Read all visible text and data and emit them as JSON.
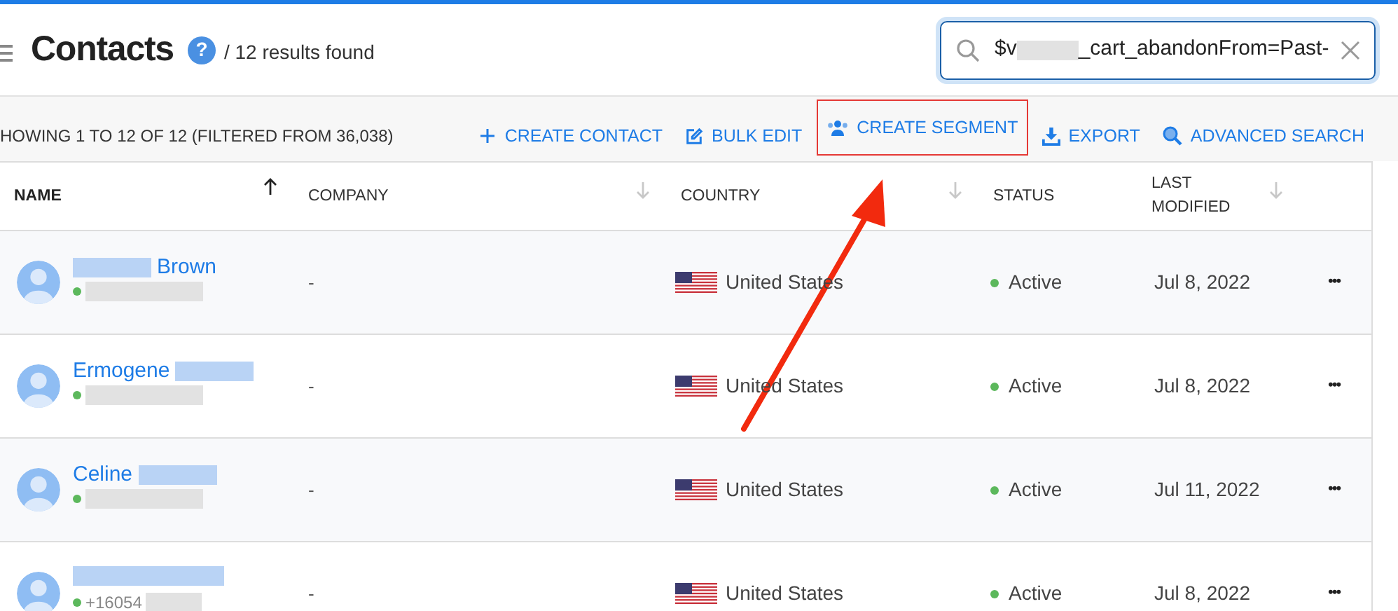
{
  "header": {
    "title": "Contacts",
    "help": "?",
    "results": "/ 12 results found"
  },
  "search": {
    "value_parts": [
      {
        "kind": "text",
        "text": "$v"
      },
      {
        "kind": "redacted"
      },
      {
        "kind": "text",
        "text": "_cart_abandonFrom=Past-"
      }
    ]
  },
  "summary": "HOWING 1 TO 12 OF 12 (FILTERED FROM 36,038)",
  "actions": [
    {
      "kind": "plus",
      "label": "CREATE CONTACT",
      "highlighted": false
    },
    {
      "kind": "edit",
      "label": "BULK EDIT",
      "highlighted": false
    },
    {
      "kind": "people",
      "label": "CREATE SEGMENT",
      "highlighted": true
    },
    {
      "kind": "download",
      "label": "EXPORT",
      "highlighted": false
    },
    {
      "kind": "zoom",
      "label": "ADVANCED SEARCH",
      "highlighted": false
    }
  ],
  "table": {
    "columns": [
      {
        "label": "NAME",
        "kind": "sorted"
      },
      {
        "label": "COMPANY",
        "kind": "sortable"
      },
      {
        "label": "COUNTRY",
        "kind": "sortable"
      },
      {
        "label": "STATUS",
        "kind": "plain"
      },
      {
        "label": "LAST MODIFIED",
        "kind": "sortable"
      }
    ],
    "rows": [
      {
        "name_parts": [
          {
            "kind": "redacted"
          },
          {
            "kind": "text",
            "text": "Brown"
          }
        ],
        "phone_parts": [
          {
            "kind": "redacted"
          }
        ],
        "company": "-",
        "country": "United States",
        "status": "Active",
        "modified": "Jul 8, 2022",
        "menu": "•••"
      },
      {
        "name_parts": [
          {
            "kind": "text",
            "text": "Ermogene"
          },
          {
            "kind": "redacted"
          }
        ],
        "phone_parts": [
          {
            "kind": "redacted"
          }
        ],
        "company": "-",
        "country": "United States",
        "status": "Active",
        "modified": "Jul 8, 2022",
        "menu": "•••"
      },
      {
        "name_parts": [
          {
            "kind": "text",
            "text": "Celine"
          },
          {
            "kind": "redacted"
          }
        ],
        "phone_parts": [
          {
            "kind": "redacted"
          }
        ],
        "company": "-",
        "country": "United States",
        "status": "Active",
        "modified": "Jul 11, 2022",
        "menu": "•••"
      },
      {
        "name_parts": [
          {
            "kind": "redacted"
          }
        ],
        "phone_parts": [
          {
            "kind": "text",
            "text": "+16054"
          },
          {
            "kind": "redacted"
          }
        ],
        "company": "-",
        "country": "United States",
        "status": "Active",
        "modified": "Jul 8, 2022",
        "menu": "•••"
      }
    ]
  }
}
